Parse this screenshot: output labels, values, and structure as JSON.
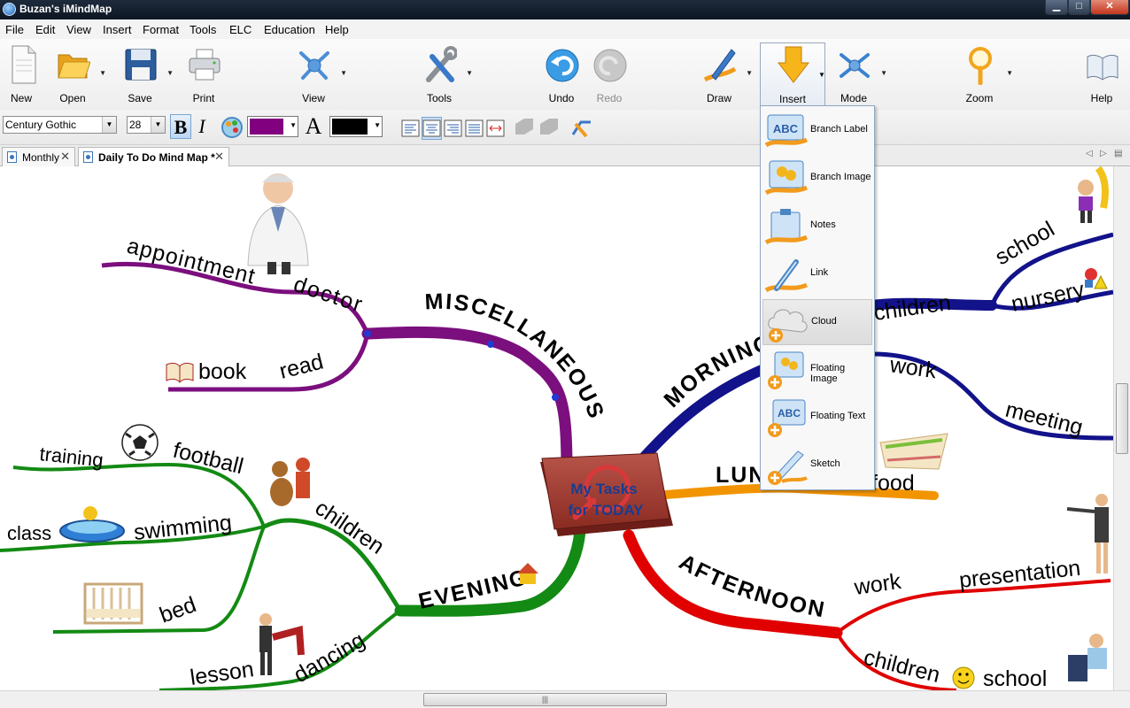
{
  "window": {
    "title": "Buzan's iMindMap",
    "minimize_label": "▁",
    "maximize_label": "□",
    "close_label": "✕"
  },
  "menu": [
    "File",
    "Edit",
    "View",
    "Insert",
    "Format",
    "Tools",
    "ELC",
    "Education",
    "Help"
  ],
  "toolbar": {
    "new_label": "New",
    "open_label": "Open",
    "save_label": "Save",
    "print_label": "Print",
    "view_label": "View",
    "tools_label": "Tools",
    "undo_label": "Undo",
    "redo_label": "Redo",
    "draw_label": "Draw",
    "insert_label": "Insert",
    "mode_label": "Mode",
    "zoom_label": "Zoom",
    "help_label": "Help"
  },
  "format": {
    "font_family": "Century Gothic",
    "font_size": "28",
    "bold_label": "B",
    "italic_label": "I",
    "fill_color": "#800080",
    "text_color_label": "A",
    "text_color": "#000000"
  },
  "tabs": [
    {
      "label": "Monthly",
      "active": false
    },
    {
      "label": "Daily To Do Mind Map *",
      "active": true
    }
  ],
  "insert_menu": [
    {
      "label": "Branch Label",
      "icon": "abc-icon"
    },
    {
      "label": "Branch Image",
      "icon": "image-icon"
    },
    {
      "label": "Notes",
      "icon": "notes-icon"
    },
    {
      "label": "Link",
      "icon": "link-icon"
    },
    {
      "label": "Cloud",
      "icon": "cloud-icon"
    },
    {
      "label": "Floating Image",
      "icon": "floating-image-icon"
    },
    {
      "label": "Floating Text",
      "icon": "floating-text-icon"
    },
    {
      "label": "Sketch",
      "icon": "sketch-icon"
    }
  ],
  "mindmap": {
    "central_title_line1": "My Tasks",
    "central_title_line2": "for TODAY",
    "branches": {
      "misc": {
        "label": "MISCELLANEOUS",
        "color": "#7b0f7e",
        "doctor": "doctor",
        "appointment": "appointment",
        "read": "read",
        "book": "book"
      },
      "morning": {
        "label": "MORNING",
        "color": "#12128a",
        "children": "children",
        "school": "school",
        "nursery": "nursery",
        "work": "work",
        "meeting": "meeting"
      },
      "lunch": {
        "label": "LUNCH",
        "color": "#f29400",
        "food": "food"
      },
      "afternoon": {
        "label": "AFTERNOON",
        "color": "#e00000",
        "work": "work",
        "presentation": "presentation",
        "children": "children",
        "school": "school"
      },
      "evening": {
        "label": "EVENING",
        "color": "#138a13",
        "children": "children",
        "football": "football",
        "training": "training",
        "swimming": "swimming",
        "class": "class",
        "bed": "bed",
        "dancing": "dancing",
        "lesson": "lesson"
      }
    }
  }
}
